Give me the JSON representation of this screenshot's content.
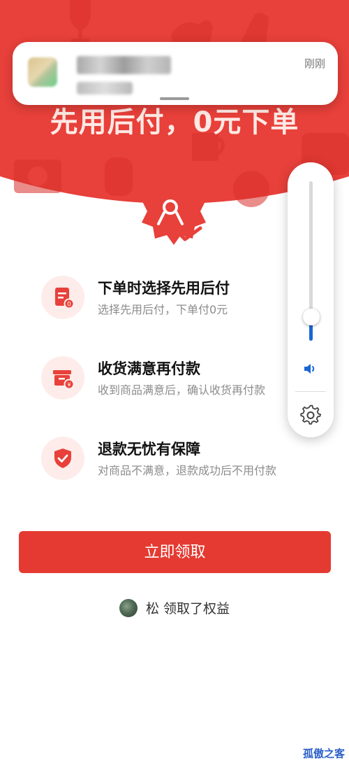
{
  "hero": {
    "slogan": "先用后付，0元下单",
    "background_color": "#e8403a"
  },
  "notification": {
    "time": "刚刚"
  },
  "features": [
    {
      "title": "下单时选择先用后付",
      "desc": "选择先用后付，下单付0元",
      "icon": "order-document-icon"
    },
    {
      "title": "收货满意再付款",
      "desc": "收到商品满意后，确认收货再付款",
      "icon": "payment-box-icon"
    },
    {
      "title": "退款无忧有保障",
      "desc": "对商品不满意，退款成功后不用付款",
      "icon": "shield-check-icon"
    }
  ],
  "cta": {
    "label": "立即领取",
    "color": "#e43a31"
  },
  "claimed": {
    "text": "松 领取了权益"
  },
  "volume": {
    "level_fraction": 0.15,
    "accent": "#1a66d6"
  },
  "watermark": {
    "text": "孤傲之客"
  }
}
